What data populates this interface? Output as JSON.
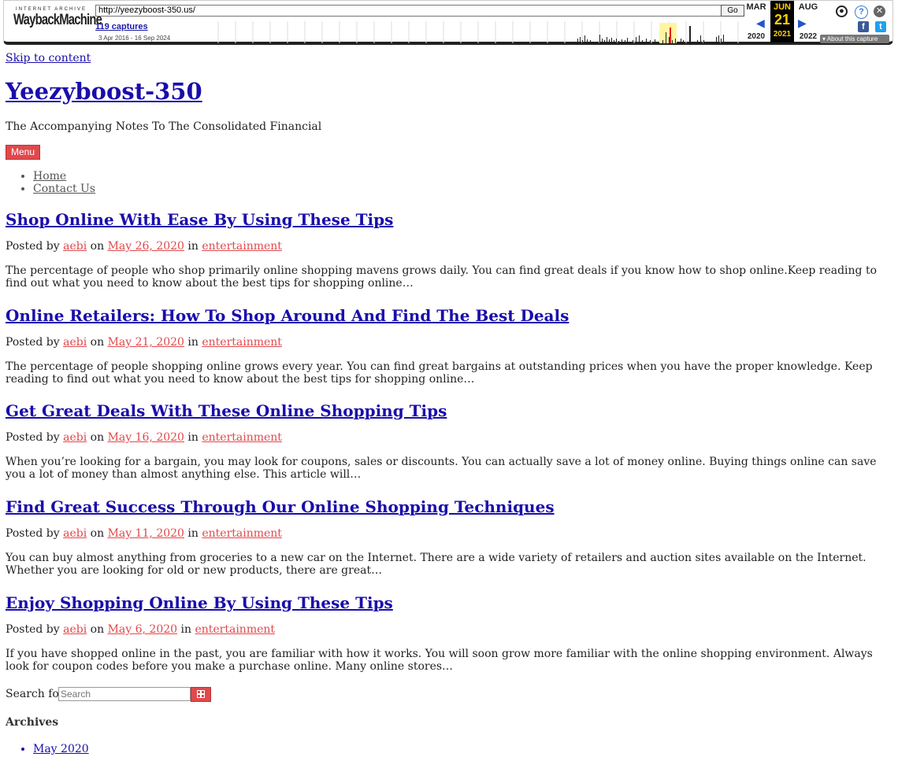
{
  "wayback": {
    "logo_top": "INTERNET ARCHIVE",
    "logo_main": "WaybackMachine",
    "url": "http://yeezyboost-350.us/",
    "go_label": "Go",
    "captures": "119 captures",
    "range": "3 Apr 2016 - 16 Sep 2024",
    "prev_month": "MAR",
    "cur_month": "JUN",
    "next_month": "AUG",
    "cur_day": "21",
    "prev_year": "2020",
    "cur_year": "2021",
    "next_year": "2022",
    "about": "About this capture",
    "facebook": "f",
    "twitter": "t"
  },
  "skip_link": "Skip to content",
  "site": {
    "title": "Yeezyboost-350",
    "tagline": "The Accompanying Notes To The Consolidated Financial",
    "menu_label": "Menu"
  },
  "nav": {
    "items": [
      "Home",
      "Contact Us"
    ]
  },
  "posts": [
    {
      "title": "Shop Online With Ease By Using These Tips",
      "posted_by": "Posted by",
      "author": "aebi",
      "on": "on",
      "date": "May 26, 2020",
      "in": "in",
      "category": "entertainment",
      "excerpt": "The percentage of people who shop primarily online shopping mavens grows daily. You can find great deals if you know how to shop online.Keep reading to find out what you need to know about the best tips for shopping online…"
    },
    {
      "title": "Online Retailers: How To Shop Around And Find The Best Deals",
      "posted_by": "Posted by",
      "author": "aebi",
      "on": "on",
      "date": "May 21, 2020",
      "in": "in",
      "category": "entertainment",
      "excerpt": "The percentage of people shopping online grows every year. You can find great bargains at outstanding prices when you have the proper knowledge. Keep reading to find out what you need to know about the best tips for shopping online…"
    },
    {
      "title": "Get Great Deals With These Online Shopping Tips",
      "posted_by": "Posted by",
      "author": "aebi",
      "on": "on",
      "date": "May 16, 2020",
      "in": "in",
      "category": "entertainment",
      "excerpt": "When you’re looking for a bargain, you may look for coupons, sales or discounts. You can actually save a lot of money online. Buying things online can save you a lot of money than almost anything else. This article will…"
    },
    {
      "title": "Find Great Success Through Our Online Shopping Techniques",
      "posted_by": "Posted by",
      "author": "aebi",
      "on": "on",
      "date": "May 11, 2020",
      "in": "in",
      "category": "entertainment",
      "excerpt": "You can buy almost anything from groceries to a new car on the Internet. There are a wide variety of retailers and auction sites available on the Internet. Whether you are looking for old or new products, there are great…"
    },
    {
      "title": "Enjoy Shopping Online By Using These Tips",
      "posted_by": "Posted by",
      "author": "aebi",
      "on": "on",
      "date": "May 6, 2020",
      "in": "in",
      "category": "entertainment",
      "excerpt": "If you have shopped online in the past, you are familiar with how it works. You will soon grow more familiar with the online shopping environment. Always look for coupon codes before you make a purchase online. Many online stores…"
    }
  ],
  "search": {
    "label": "Search for:",
    "placeholder": "Search",
    "button_icon": "search-icon"
  },
  "archives": {
    "heading": "Archives",
    "items": [
      "May 2020"
    ]
  },
  "colors": {
    "accent": "#e0494c",
    "link": "#1a0dab",
    "toolbar_highlight": "#ffd000"
  }
}
